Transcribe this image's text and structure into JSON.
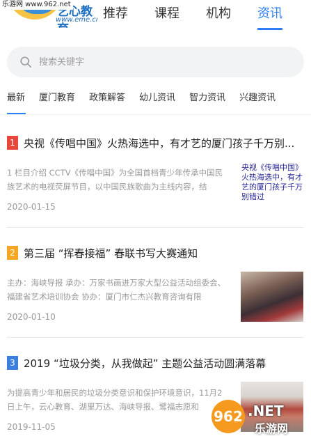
{
  "watermark_top": "乐游网 www.962.net",
  "logo": {
    "text": "艺心教育",
    "url": "www.eme.cn"
  },
  "nav": [
    {
      "label": "推荐"
    },
    {
      "label": "课程"
    },
    {
      "label": "机构"
    },
    {
      "label": "资讯",
      "active": true
    }
  ],
  "search": {
    "placeholder": "搜索关键字"
  },
  "tabs": [
    {
      "label": "最新",
      "active": true
    },
    {
      "label": "厦门教育"
    },
    {
      "label": "政策解答"
    },
    {
      "label": "幼儿资讯"
    },
    {
      "label": "智力资讯"
    },
    {
      "label": "兴趣资讯"
    }
  ],
  "articles": [
    {
      "rank": "1",
      "rank_color": "#e8453c",
      "title": "央视《传唱中国》火热海选中，有才艺的厦门孩子千万别...",
      "summary": "1 栏目介绍 CCTV《传唱中国》为全国首档青少年传承中国民族艺术的电视荧屏节目，以中国民族歌曲为主线内容，结",
      "date": "2020-01-15",
      "thumb_text": "央视《传唱中国》火热海选中，有才艺的厦门孩子千万别错过"
    },
    {
      "rank": "2",
      "rank_color": "#f5a623",
      "title": "第三届 “挥春接福” 春联书写大赛通知",
      "summary": "主办：海峡导报 承办：万家书画进万家大型公益活动组委会、福建省艺术培训协会 协办：厦门市仁杰兴教育咨询有限",
      "date": "2020-01-10"
    },
    {
      "rank": "3",
      "rank_color": "#3a7fe0",
      "title": "2019 “垃圾分类，从我做起” 主题公益活动圆满落幕",
      "summary": "为提高青少年和居民的垃圾分类意识和保护环境意识，11月2日上午，云心教育、湖里万达、海峡导报、鹭福志愿和",
      "date": "2019-11-05"
    }
  ],
  "watermark_bottom": {
    "num": "962",
    "net": ".NET",
    "cn": "乐游网"
  }
}
